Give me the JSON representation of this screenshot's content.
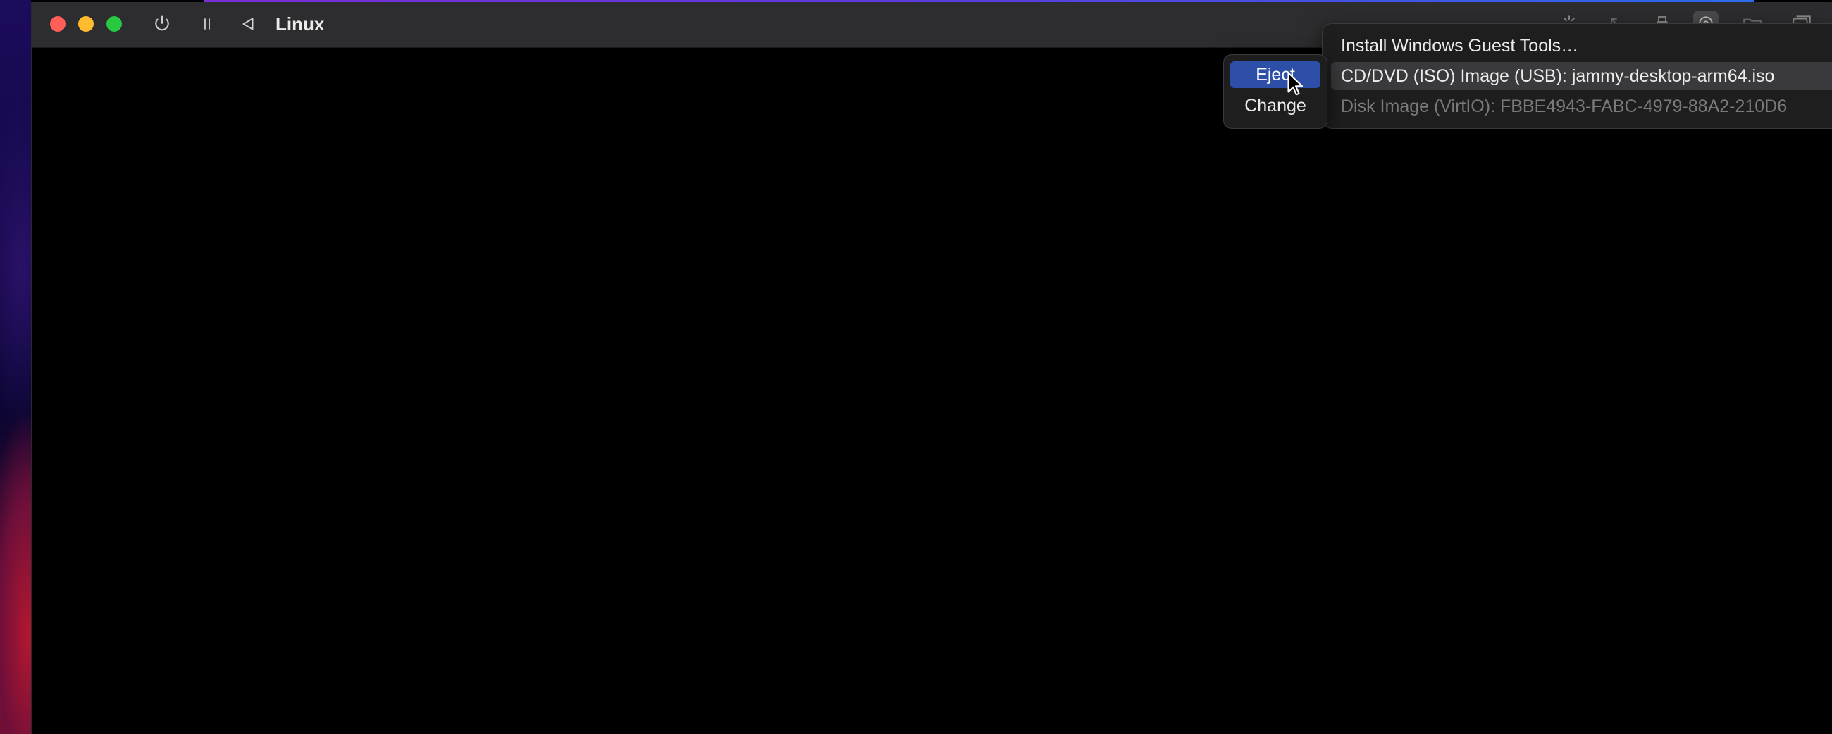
{
  "window": {
    "title": "Linux"
  },
  "toolbar": {
    "left_icons": [
      "power-icon",
      "pause-icon",
      "back-icon"
    ],
    "right_icons": [
      "activity-icon",
      "cursor-capture-icon",
      "usb-icon",
      "drive-icon",
      "shared-folder-icon",
      "windows-icon"
    ]
  },
  "drive_menu": {
    "items": [
      {
        "label": "Install Windows Guest Tools…",
        "state": "normal"
      },
      {
        "label": "CD/DVD (ISO) Image (USB): jammy-desktop-arm64.iso",
        "state": "highlighted"
      },
      {
        "label": "Disk Image (VirtIO): FBBE4943-FABC-4979-88A2-210D6",
        "state": "disabled"
      }
    ]
  },
  "submenu": {
    "eject_label": "Eject",
    "change_label": "Change"
  },
  "colors": {
    "selection": "#2d4fa8",
    "titlebar": "#2d2c2e",
    "menu_bg": "#1e1e1f"
  }
}
